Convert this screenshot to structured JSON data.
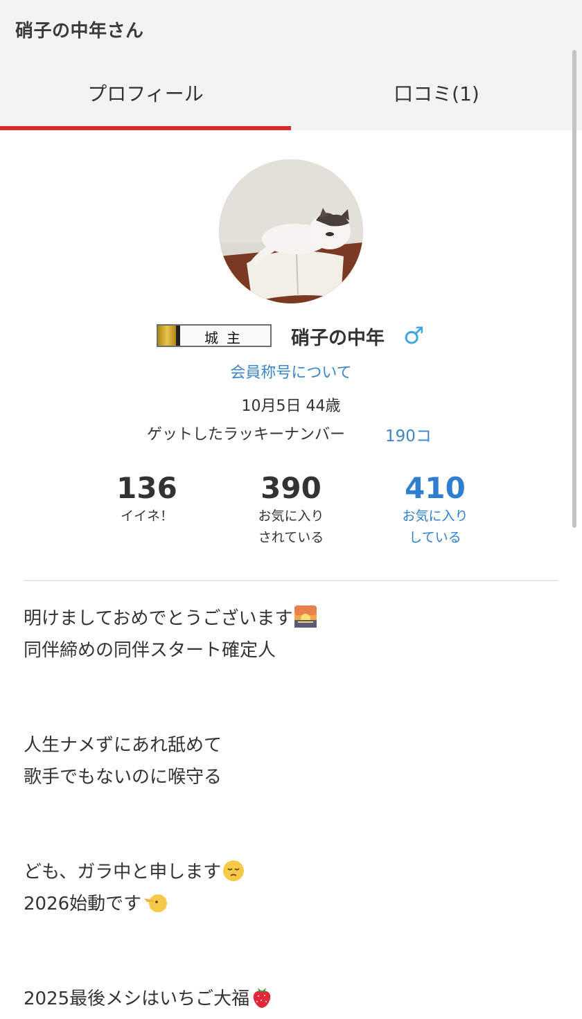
{
  "header": {
    "title": "硝子の中年さん",
    "tabs": [
      {
        "label": "プロフィール",
        "active": true
      },
      {
        "label": "口コミ(1)",
        "active": false
      }
    ],
    "active_color": "#d72a2a"
  },
  "profile": {
    "avatar_icon": "cat-avatar",
    "rank_badge_text": "城主",
    "name": "硝子の中年",
    "gender_symbol": "♂",
    "title_link": "会員称号について",
    "birthday_age": "10月5日 44歳",
    "lucky_label": "ゲットしたラッキーナンバー",
    "lucky_count": "190コ",
    "link_color": "#3b86c8"
  },
  "stats": [
    {
      "value": "136",
      "label_line1": "イイネ！",
      "label_line2": ""
    },
    {
      "value": "390",
      "label_line1": "お気に入り",
      "label_line2": "されている"
    },
    {
      "value": "410",
      "label_line1": "お気に入り",
      "label_line2": "している"
    }
  ],
  "bio": {
    "paragraphs": [
      {
        "line1": "明けましておめでとうございます",
        "line1_icon": "sunrise-emoji-icon",
        "line2": "同伴締めの同伴スタート確定人"
      },
      {
        "line1": "人生ナメずにあれ舐めて",
        "line2": "歌手でもないのに喉守る"
      },
      {
        "line1": "ども、ガラ中と申します",
        "line1_icon": "pensive-face-emoji-icon",
        "line2": "2026始動です",
        "line2_icon": "pointing-face-emoji-icon"
      },
      {
        "line1": "2025最後メシはいちご大福",
        "line1_icon": "strawberry-emoji-icon"
      }
    ]
  }
}
